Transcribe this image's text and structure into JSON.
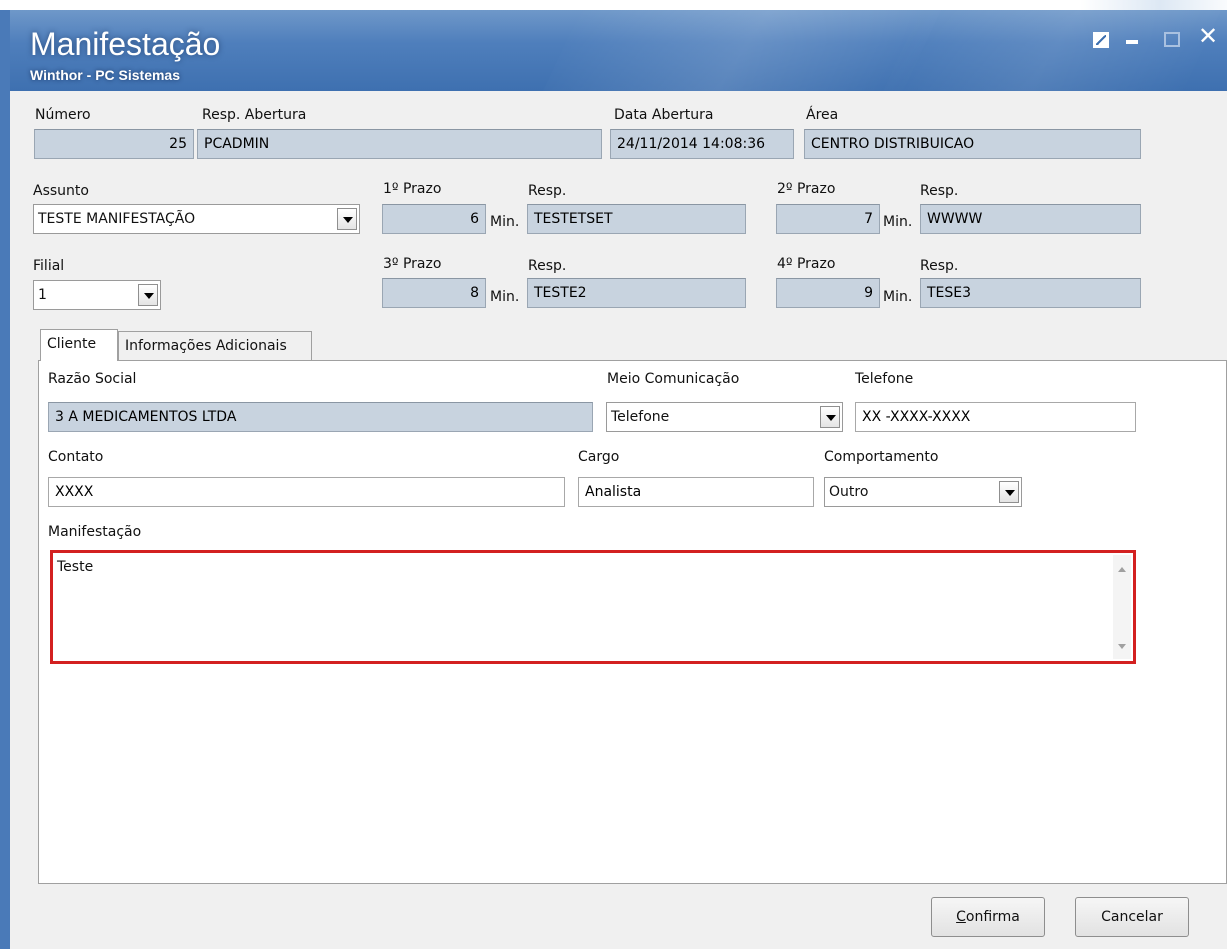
{
  "window": {
    "title": "Manifestação",
    "subtitle": "Winthor - PC Sistemas",
    "colors": {
      "titlebar": "#4f7fbc",
      "readonly_field": "#c8d3df",
      "highlight_border": "#d32020"
    }
  },
  "header": {
    "numero": {
      "label": "Número",
      "value": "25"
    },
    "resp_abertura": {
      "label": "Resp. Abertura",
      "value": "PCADMIN"
    },
    "data_abertura": {
      "label": "Data Abertura",
      "value": "24/11/2014 14:08:36"
    },
    "area": {
      "label": "Área",
      "value": "CENTRO DISTRIBUICAO"
    }
  },
  "assunto": {
    "label": "Assunto",
    "value": "TESTE MANIFESTAÇÃO"
  },
  "filial": {
    "label": "Filial",
    "value": "1"
  },
  "prazos": {
    "unit": "Min.",
    "resp_label": "Resp.",
    "p1": {
      "label": "1º Prazo",
      "value": "6",
      "resp": "TESTETSET"
    },
    "p2": {
      "label": "2º Prazo",
      "value": "7",
      "resp": "WWWW"
    },
    "p3": {
      "label": "3º Prazo",
      "value": "8",
      "resp": "TESTE2"
    },
    "p4": {
      "label": "4º Prazo",
      "value": "9",
      "resp": "TESE3"
    }
  },
  "tabs": {
    "cliente": "Cliente",
    "info": "Informações Adicionais"
  },
  "cliente": {
    "razao_social": {
      "label": "Razão Social",
      "value": "3 A MEDICAMENTOS LTDA"
    },
    "meio_comunicacao": {
      "label": "Meio Comunicação",
      "value": "Telefone"
    },
    "telefone": {
      "label": "Telefone",
      "value": "XX -XXXX-XXXX"
    },
    "contato": {
      "label": "Contato",
      "value": "XXXX"
    },
    "cargo": {
      "label": "Cargo",
      "value": "Analista"
    },
    "comportamento": {
      "label": "Comportamento",
      "value": "Outro"
    },
    "manifestacao": {
      "label": "Manifestação",
      "value": "Teste"
    }
  },
  "buttons": {
    "confirma": {
      "first": "C",
      "rest": "onfirma"
    },
    "cancelar": "Cancelar"
  }
}
